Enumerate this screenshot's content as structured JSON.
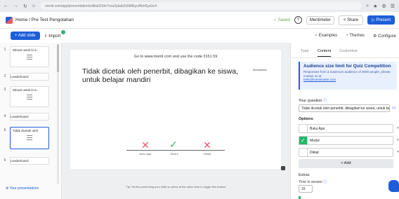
{
  "browser": {
    "nav_back": "←",
    "nav_forward": "→",
    "nav_reload": "↻",
    "nav_home": "⌂",
    "url": "menti.com/app/presentation/edit/al1h0n7nzu2ykab2s5k8kyu46m6ya1e4",
    "ext_icons": [
      "⌕",
      "★",
      "⚙",
      "☰"
    ]
  },
  "header": {
    "breadcrumb": "Home / Pre Test Pengolahan",
    "saved_label": "Saved",
    "help_label": "?",
    "user_label": "Mentimeter",
    "share_label": "Share",
    "present_label": "Present"
  },
  "toolbar": {
    "add_slide_label": "+ Add slide",
    "import_label": "Import",
    "examples_label": "Examples",
    "themes_label": "Themes",
    "configure_label": "Configure"
  },
  "sidebar": {
    "slides": [
      {
        "num": "1",
        "title": "Dibuat untuk ki d..",
        "type": "thumb"
      },
      {
        "num": "2",
        "title": "Leaderboard",
        "type": "leader"
      },
      {
        "num": "3",
        "title": "Dibuat untuk ki d..",
        "type": "thumb"
      },
      {
        "num": "4",
        "title": "Leaderboard",
        "type": "leader"
      },
      {
        "num": "5",
        "title": "Tidak dicetak oleh",
        "type": "thumb",
        "selected": true
      },
      {
        "num": "6",
        "title": "Leaderboard",
        "type": "leader"
      }
    ],
    "your_presentations": "Your presentations"
  },
  "slide": {
    "join_text": "Go to www.menti.com and use the code 3151 59",
    "question": "Tidak dicetak oleh penerbit, dibagikan ke siswa, untuk belajar mandiri",
    "logo_text": "Mentimeter",
    "options": [
      {
        "label": "Buku Ajar",
        "correct": false
      },
      {
        "label": "Modul",
        "correct": true
      },
      {
        "label": "Diktat",
        "correct": false
      }
    ],
    "hint": "Tip: Hit this presenting your slide so press at the same time to toggle this feature"
  },
  "panel": {
    "tabs": [
      "Type",
      "Content",
      "Customize"
    ],
    "active_tab": "Content",
    "info_title": "Audience size limit for Quiz Competition",
    "info_desc": "Responses from a maximum audience of 2000 people, please contact us at",
    "info_link": "hello@mentimeter.com",
    "your_question_label": "Your question",
    "question_value": "Tidak dicetak oleh penerbit, dibagikan ke siswa, untuk belajar mandiri",
    "options_label": "Options",
    "options": [
      {
        "label": "Buku Ajar",
        "checked": false
      },
      {
        "label": "Modul",
        "checked": true
      },
      {
        "label": "Diktat",
        "checked": false
      }
    ],
    "add_label": "+ Add",
    "extras_label": "Extras",
    "time_label": "Time to answer",
    "time_value": "15"
  },
  "colors": {
    "accent": "#1d5ed8",
    "correct": "#2db36a",
    "wrong": "#e8566d"
  }
}
